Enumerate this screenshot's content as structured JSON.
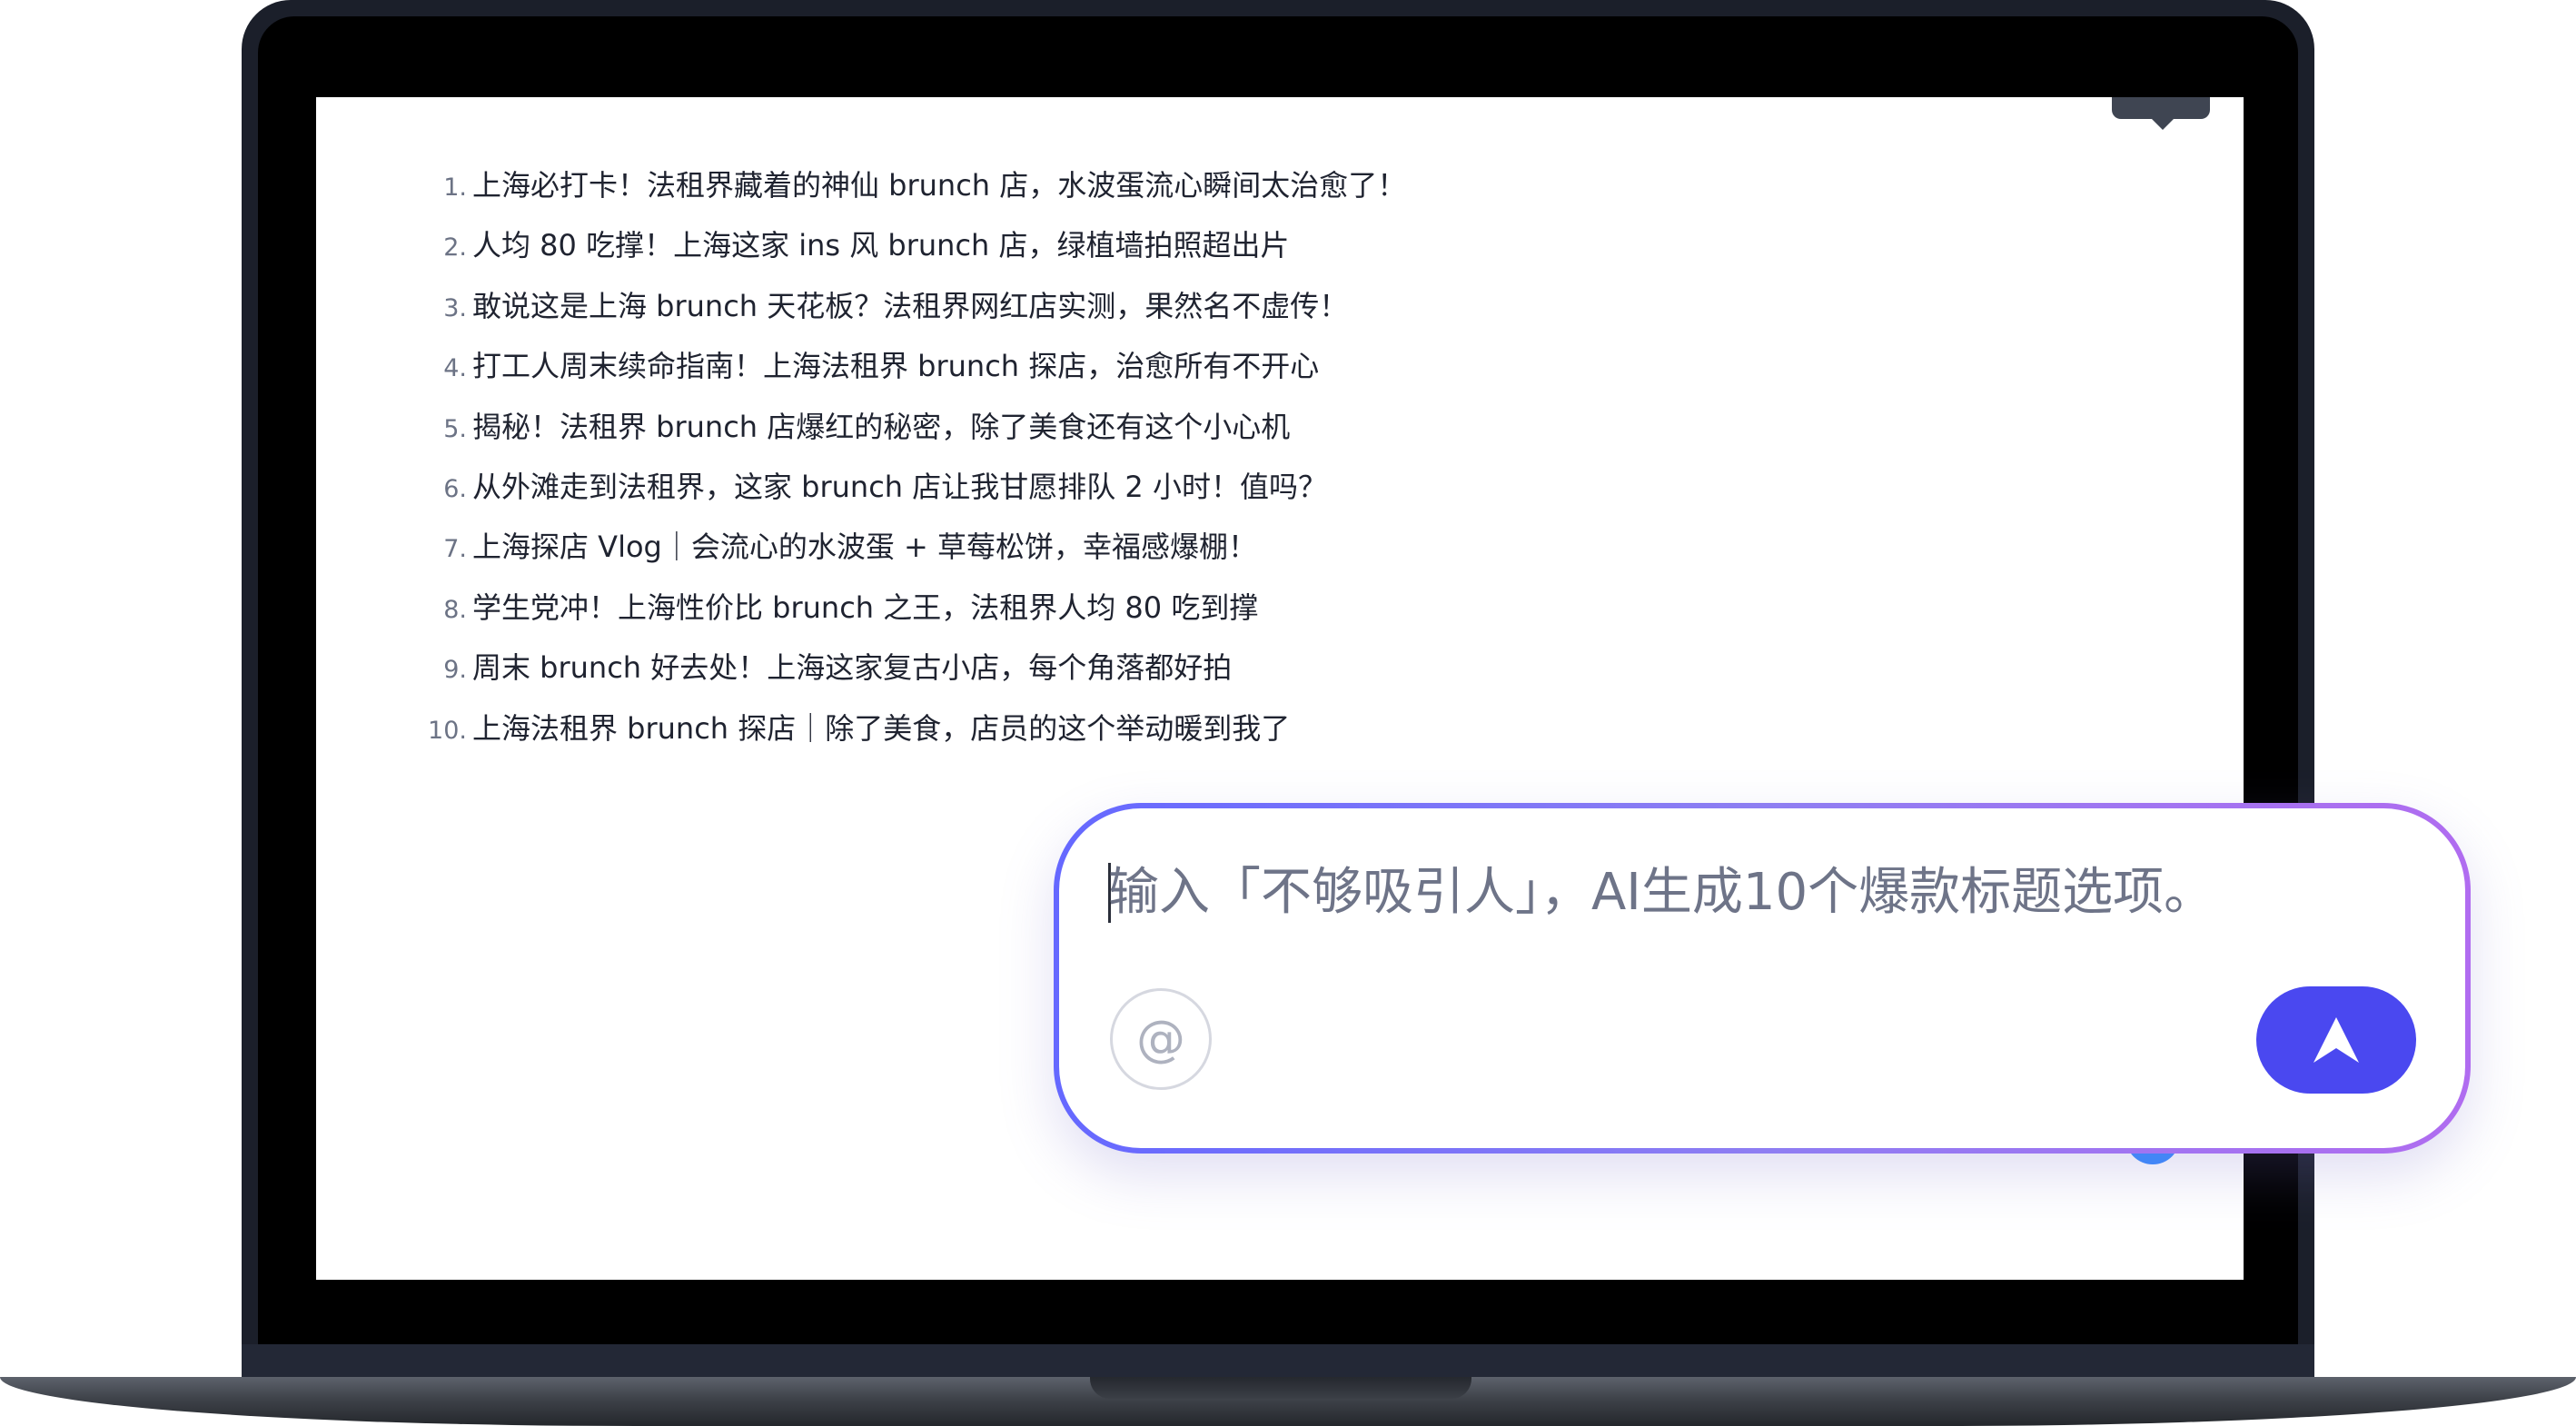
{
  "tooltip": {
    "label": ""
  },
  "titles": [
    {
      "num": "1.",
      "text": "上海必打卡！法租界藏着的神仙 brunch 店，水波蛋流心瞬间太治愈了！"
    },
    {
      "num": "2.",
      "text": "人均 80 吃撑！上海这家 ins 风 brunch 店，绿植墙拍照超出片"
    },
    {
      "num": "3.",
      "text": "敢说这是上海 brunch 天花板？法租界网红店实测，果然名不虚传！"
    },
    {
      "num": "4.",
      "text": "打工人周末续命指南！上海法租界 brunch 探店，治愈所有不开心"
    },
    {
      "num": "5.",
      "text": "揭秘！法租界 brunch 店爆红的秘密，除了美食还有这个小心机"
    },
    {
      "num": "6.",
      "text": "从外滩走到法租界，这家 brunch 店让我甘愿排队 2 小时！值吗？"
    },
    {
      "num": "7.",
      "text": "上海探店 Vlog｜会流心的水波蛋 + 草莓松饼，幸福感爆棚！"
    },
    {
      "num": "8.",
      "text": "学生党冲！上海性价比 brunch 之王，法租界人均 80 吃到撑"
    },
    {
      "num": "9.",
      "text": "周末 brunch 好去处！上海这家复古小店，每个角落都好拍"
    },
    {
      "num": "10.",
      "text": "上海法租界 brunch 探店｜除了美食，店员的这个举动暖到我了"
    }
  ],
  "composer": {
    "placeholder": "输入「不够吸引人」，AI生成10个爆款标题选项。",
    "value": "",
    "mention_symbol": "@",
    "send_icon": "send-arrow-icon"
  },
  "colors": {
    "accent": "#4a48f0",
    "gradient_start": "#6568ff",
    "gradient_end": "#b06cf0",
    "dot": "#3a8bff"
  }
}
